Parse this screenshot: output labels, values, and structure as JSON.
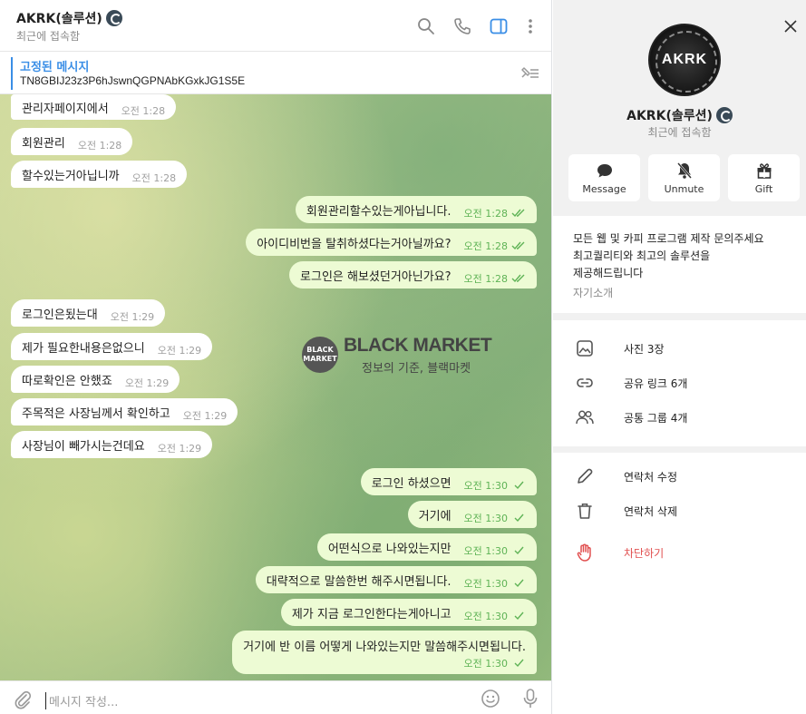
{
  "chat_header": {
    "title": "AKRK(솔루션)",
    "status": "최근에 접속함"
  },
  "pinned": {
    "title": "고정된 메시지",
    "text": "TN8GBIJ23z3P6hJswnQGPNAbKGxkJG1S5E"
  },
  "watermark": {
    "logo_text": "BLACK MARKET",
    "title": "BLACK MARKET",
    "subtitle": "정보의 기준, 블랙마켓"
  },
  "messages": [
    {
      "dir": "in",
      "text": "관리자페이지에서",
      "time": "오전 1:28"
    },
    {
      "dir": "in",
      "text": "회원관리",
      "time": "오전 1:28"
    },
    {
      "dir": "in",
      "text": "할수있는거아닙니까",
      "time": "오전 1:28"
    },
    {
      "dir": "out",
      "text": "회원관리할수있는게아닙니다.",
      "time": "오전 1:28"
    },
    {
      "dir": "out",
      "text": "아이디비번을 탈취하셨다는거아닐까요?",
      "time": "오전 1:28"
    },
    {
      "dir": "out",
      "text": "로그인은 해보셨던거아닌가요?",
      "time": "오전 1:28"
    },
    {
      "dir": "in",
      "text": "로그인은됬는대",
      "time": "오전 1:29"
    },
    {
      "dir": "in",
      "text": "제가 필요한내용은없으니",
      "time": "오전 1:29"
    },
    {
      "dir": "in",
      "text": "따로확인은 안했죠",
      "time": "오전 1:29"
    },
    {
      "dir": "in",
      "text": "주목적은 사장님께서 확인하고",
      "time": "오전 1:29"
    },
    {
      "dir": "in",
      "text": "사장님이 빼가시는건데요",
      "time": "오전 1:29"
    },
    {
      "dir": "out",
      "text": "로그인 하셨으면",
      "time": "오전 1:30"
    },
    {
      "dir": "out",
      "text": "거기에",
      "time": "오전 1:30"
    },
    {
      "dir": "out",
      "text": "어떤식으로 나와있는지만",
      "time": "오전 1:30"
    },
    {
      "dir": "out",
      "text": "대략적으로 말씀한번 해주시면됩니다.",
      "time": "오전 1:30"
    },
    {
      "dir": "out",
      "text": "제가 지금 로그인한다는게아니고",
      "time": "오전 1:30"
    },
    {
      "dir": "out",
      "text": "거기에 반 이름 어떻게 나와있는지만 말씀해주시면됩니다.",
      "time": "오전 1:30"
    }
  ],
  "composer": {
    "placeholder": "메시지 작성..."
  },
  "profile": {
    "avatar_text": "AKRK",
    "name": "AKRK(솔루션)",
    "status": "최근에 접속함",
    "actions": {
      "message": "Message",
      "unmute": "Unmute",
      "gift": "Gift"
    },
    "bio": {
      "line1": "모든 웹 및 카피 프로그램 제작 문의주세요",
      "line2": "최고퀄리티와 최고의 솔루션을",
      "line3": "제공해드립니다",
      "label": "자기소개"
    },
    "media": {
      "photos": "사진 3장",
      "links": "공유 링크 6개",
      "groups": "공통 그룹 4개"
    },
    "contact_actions": {
      "edit": "연락처 수정",
      "delete": "연락처 삭제",
      "block": "차단하기"
    }
  },
  "colors": {
    "accent": "#3a8ee6",
    "outgoing_bubble": "#edfbd4",
    "check": "#5fb356",
    "danger": "#e15050"
  }
}
